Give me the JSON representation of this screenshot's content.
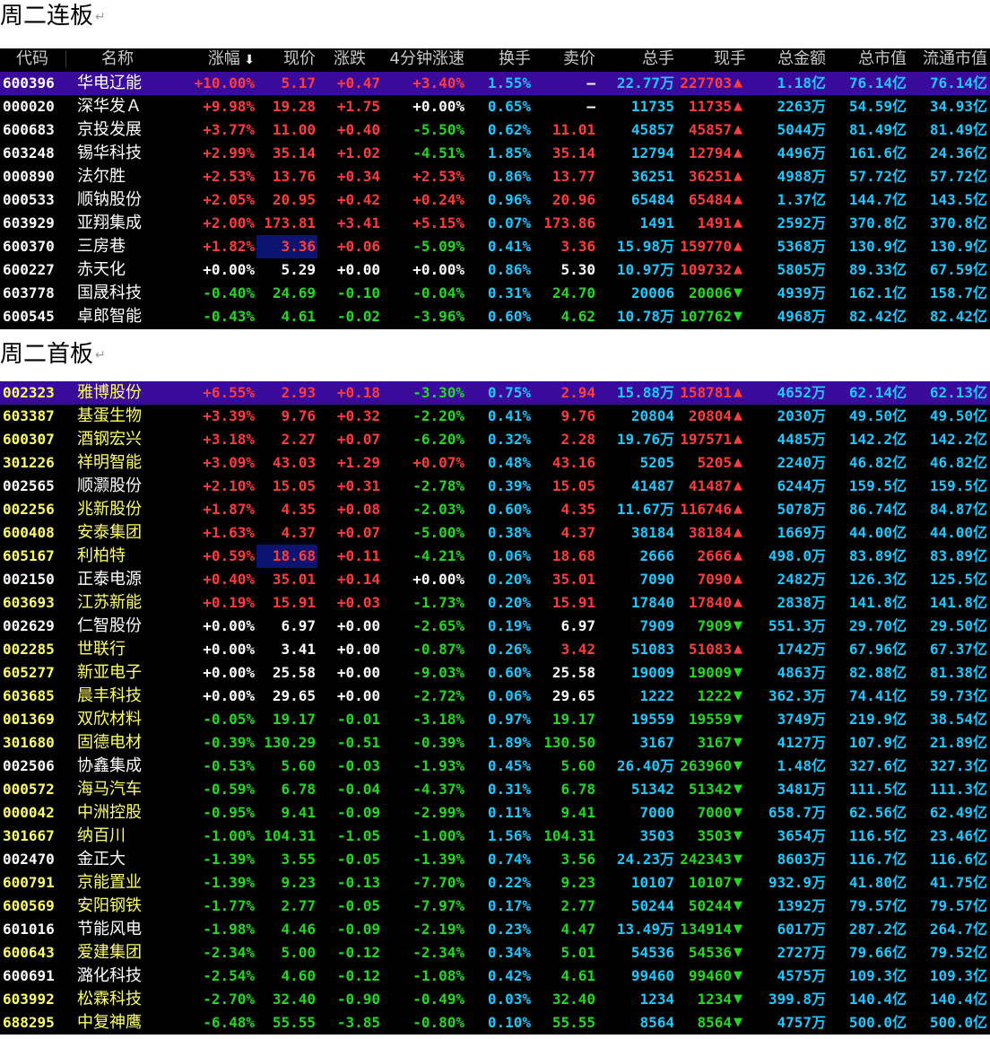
{
  "colors": {
    "up": "#ff3b3b",
    "down": "#22d822",
    "flat": "#ffffff",
    "cyan": "#1ec8ff",
    "yellow": "#ffff66",
    "header": "#c8c8c8",
    "selected_bg": "#3a0a9a",
    "highlight_bg": "#0b1470"
  },
  "headers": {
    "code": "代码",
    "name": "名称",
    "pct": "涨幅",
    "price": "现价",
    "chg": "涨跌",
    "spd": "4分钟涨速",
    "turn": "换手",
    "sell": "卖价",
    "vol": "总手",
    "cur": "现手",
    "amt": "总金额",
    "mcap": "总市值",
    "fcap": "流通市值",
    "sort_icon": "down-arrow-icon"
  },
  "sections": [
    {
      "title": "周二连板",
      "rows": [
        {
          "code": "600396",
          "name": "华电辽能",
          "pct": "+10.00%",
          "price": "5.17",
          "chg": "+0.47",
          "spd": "+3.40%",
          "turn": "1.55%",
          "sell": "–",
          "vol": "22.77万",
          "cur": "227703",
          "dir": "up",
          "amt": "1.18亿",
          "mcap": "76.14亿",
          "fcap": "76.14亿",
          "s": "uuuu",
          "sel": true
        },
        {
          "code": "000020",
          "name": "深华发Ａ",
          "pct": "+9.98%",
          "price": "19.28",
          "chg": "+1.75",
          "spd": "+0.00%",
          "turn": "0.65%",
          "sell": "–",
          "vol": "11735",
          "cur": "11735",
          "dir": "up",
          "amt": "2263万",
          "mcap": "54.59亿",
          "fcap": "34.93亿",
          "s": "uuuf"
        },
        {
          "code": "600683",
          "name": "京投发展",
          "pct": "+3.77%",
          "price": "11.00",
          "chg": "+0.40",
          "spd": "-5.50%",
          "turn": "0.62%",
          "sell": "11.01",
          "vol": "45857",
          "cur": "45857",
          "dir": "up",
          "amt": "5044万",
          "mcap": "81.49亿",
          "fcap": "81.49亿",
          "s": "uuudu"
        },
        {
          "code": "603248",
          "name": "锡华科技",
          "pct": "+2.99%",
          "price": "35.14",
          "chg": "+1.02",
          "spd": "-4.51%",
          "turn": "1.85%",
          "sell": "35.14",
          "vol": "12794",
          "cur": "12794",
          "dir": "up",
          "amt": "4496万",
          "mcap": "161.6亿",
          "fcap": "24.36亿",
          "s": "uuudu"
        },
        {
          "code": "000890",
          "name": "法尔胜",
          "pct": "+2.53%",
          "price": "13.76",
          "chg": "+0.34",
          "spd": "+2.53%",
          "turn": "0.86%",
          "sell": "13.77",
          "vol": "36251",
          "cur": "36251",
          "dir": "up",
          "amt": "4988万",
          "mcap": "57.72亿",
          "fcap": "57.72亿",
          "s": "uuuuu"
        },
        {
          "code": "000533",
          "name": "顺钠股份",
          "pct": "+2.05%",
          "price": "20.95",
          "chg": "+0.42",
          "spd": "+0.24%",
          "turn": "0.96%",
          "sell": "20.96",
          "vol": "65484",
          "cur": "65484",
          "dir": "up",
          "amt": "1.37亿",
          "mcap": "144.7亿",
          "fcap": "143.5亿",
          "s": "uuuuu"
        },
        {
          "code": "603929",
          "name": "亚翔集成",
          "pct": "+2.00%",
          "price": "173.81",
          "chg": "+3.41",
          "spd": "+5.15%",
          "turn": "0.07%",
          "sell": "173.86",
          "vol": "1491",
          "cur": "1491",
          "dir": "up",
          "amt": "2592万",
          "mcap": "370.8亿",
          "fcap": "370.8亿",
          "s": "uuuuu"
        },
        {
          "code": "600370",
          "name": "三房巷",
          "pct": "+1.82%",
          "price": "3.36",
          "chg": "+0.06",
          "spd": "-5.09%",
          "turn": "0.41%",
          "sell": "3.36",
          "vol": "15.98万",
          "cur": "159770",
          "dir": "up",
          "amt": "5368万",
          "mcap": "130.9亿",
          "fcap": "130.9亿",
          "s": "uuudu",
          "hl": true
        },
        {
          "code": "600227",
          "name": "赤天化",
          "pct": "+0.00%",
          "price": "5.29",
          "chg": "+0.00",
          "spd": "+0.00%",
          "turn": "0.86%",
          "sell": "5.30",
          "vol": "10.97万",
          "cur": "109732",
          "dir": "up",
          "amt": "5805万",
          "mcap": "89.33亿",
          "fcap": "67.59亿",
          "s": "fffffu"
        },
        {
          "code": "603778",
          "name": "国晟科技",
          "pct": "-0.40%",
          "price": "24.69",
          "chg": "-0.10",
          "spd": "-0.04%",
          "turn": "0.31%",
          "sell": "24.70",
          "vol": "20006",
          "cur": "20006",
          "dir": "down",
          "amt": "4939万",
          "mcap": "162.1亿",
          "fcap": "158.7亿",
          "s": "ddddd"
        },
        {
          "code": "600545",
          "name": "卓郎智能",
          "pct": "-0.43%",
          "price": "4.61",
          "chg": "-0.02",
          "spd": "-3.96%",
          "turn": "0.60%",
          "sell": "4.62",
          "vol": "10.78万",
          "cur": "107762",
          "dir": "down",
          "amt": "4968万",
          "mcap": "82.42亿",
          "fcap": "82.42亿",
          "s": "ddddd"
        }
      ]
    },
    {
      "title": "周二首板",
      "rows": [
        {
          "code": "002323",
          "name": "雅博股份",
          "pct": "+6.55%",
          "price": "2.93",
          "chg": "+0.18",
          "spd": "-3.30%",
          "turn": "0.75%",
          "sell": "2.94",
          "vol": "15.88万",
          "cur": "158781",
          "dir": "up",
          "amt": "4652万",
          "mcap": "62.14亿",
          "fcap": "62.13亿",
          "s": "uuudu",
          "sel": true,
          "yc": true
        },
        {
          "code": "603387",
          "name": "基蛋生物",
          "pct": "+3.39%",
          "price": "9.76",
          "chg": "+0.32",
          "spd": "-2.20%",
          "turn": "0.41%",
          "sell": "9.76",
          "vol": "20804",
          "cur": "20804",
          "dir": "up",
          "amt": "2030万",
          "mcap": "49.50亿",
          "fcap": "49.50亿",
          "s": "uuudu",
          "yc": true
        },
        {
          "code": "600307",
          "name": "酒钢宏兴",
          "pct": "+3.18%",
          "price": "2.27",
          "chg": "+0.07",
          "spd": "-6.20%",
          "turn": "0.32%",
          "sell": "2.28",
          "vol": "19.76万",
          "cur": "197571",
          "dir": "up",
          "amt": "4485万",
          "mcap": "142.2亿",
          "fcap": "142.2亿",
          "s": "uuudu",
          "yc": true
        },
        {
          "code": "301226",
          "name": "祥明智能",
          "pct": "+3.09%",
          "price": "43.03",
          "chg": "+1.29",
          "spd": "+0.07%",
          "turn": "0.48%",
          "sell": "43.16",
          "vol": "5205",
          "cur": "5205",
          "dir": "up",
          "amt": "2240万",
          "mcap": "46.82亿",
          "fcap": "46.82亿",
          "s": "uuuuu",
          "yc": true
        },
        {
          "code": "002565",
          "name": "顺灏股份",
          "pct": "+2.10%",
          "price": "15.05",
          "chg": "+0.31",
          "spd": "-2.78%",
          "turn": "0.39%",
          "sell": "15.05",
          "vol": "41487",
          "cur": "41487",
          "dir": "up",
          "amt": "6244万",
          "mcap": "159.5亿",
          "fcap": "159.5亿",
          "s": "uuudu"
        },
        {
          "code": "002256",
          "name": "兆新股份",
          "pct": "+1.87%",
          "price": "4.35",
          "chg": "+0.08",
          "spd": "-2.03%",
          "turn": "0.60%",
          "sell": "4.35",
          "vol": "11.67万",
          "cur": "116746",
          "dir": "up",
          "amt": "5078万",
          "mcap": "86.74亿",
          "fcap": "84.87亿",
          "s": "uuudu",
          "yc": true
        },
        {
          "code": "600408",
          "name": "安泰集团",
          "pct": "+1.63%",
          "price": "4.37",
          "chg": "+0.07",
          "spd": "-5.00%",
          "turn": "0.38%",
          "sell": "4.37",
          "vol": "38184",
          "cur": "38184",
          "dir": "up",
          "amt": "1669万",
          "mcap": "44.00亿",
          "fcap": "44.00亿",
          "s": "uuudu",
          "yc": true
        },
        {
          "code": "605167",
          "name": "利柏特",
          "pct": "+0.59%",
          "price": "18.68",
          "chg": "+0.11",
          "spd": "-4.21%",
          "turn": "0.06%",
          "sell": "18.68",
          "vol": "2666",
          "cur": "2666",
          "dir": "up",
          "amt": "498.0万",
          "mcap": "83.89亿",
          "fcap": "83.89亿",
          "s": "uuudu",
          "yc": true,
          "hl": true
        },
        {
          "code": "002150",
          "name": "正泰电源",
          "pct": "+0.40%",
          "price": "35.01",
          "chg": "+0.14",
          "spd": "+0.00%",
          "turn": "0.20%",
          "sell": "35.01",
          "vol": "7090",
          "cur": "7090",
          "dir": "up",
          "amt": "2482万",
          "mcap": "126.3亿",
          "fcap": "125.5亿",
          "s": "uuufu"
        },
        {
          "code": "603693",
          "name": "江苏新能",
          "pct": "+0.19%",
          "price": "15.91",
          "chg": "+0.03",
          "spd": "-1.73%",
          "turn": "0.20%",
          "sell": "15.91",
          "vol": "17840",
          "cur": "17840",
          "dir": "up",
          "amt": "2838万",
          "mcap": "141.8亿",
          "fcap": "141.8亿",
          "s": "uuudu",
          "yc": true
        },
        {
          "code": "002629",
          "name": "仁智股份",
          "pct": "+0.00%",
          "price": "6.97",
          "chg": "+0.00",
          "spd": "-2.65%",
          "turn": "0.19%",
          "sell": "6.97",
          "vol": "7909",
          "cur": "7909",
          "dir": "down",
          "amt": "551.3万",
          "mcap": "29.70亿",
          "fcap": "29.50亿",
          "s": "fffdf"
        },
        {
          "code": "002285",
          "name": "世联行",
          "pct": "+0.00%",
          "price": "3.41",
          "chg": "+0.00",
          "spd": "-0.87%",
          "turn": "0.26%",
          "sell": "3.42",
          "vol": "51083",
          "cur": "51083",
          "dir": "up",
          "amt": "1742万",
          "mcap": "67.96亿",
          "fcap": "67.37亿",
          "s": "fffdu",
          "yc": true
        },
        {
          "code": "605277",
          "name": "新亚电子",
          "pct": "+0.00%",
          "price": "25.58",
          "chg": "+0.00",
          "spd": "-9.03%",
          "turn": "0.60%",
          "sell": "25.58",
          "vol": "19009",
          "cur": "19009",
          "dir": "down",
          "amt": "4863万",
          "mcap": "82.88亿",
          "fcap": "81.38亿",
          "s": "fffdf",
          "yc": true
        },
        {
          "code": "603685",
          "name": "晨丰科技",
          "pct": "+0.00%",
          "price": "29.65",
          "chg": "+0.00",
          "spd": "-2.72%",
          "turn": "0.06%",
          "sell": "29.65",
          "vol": "1222",
          "cur": "1222",
          "dir": "down",
          "amt": "362.3万",
          "mcap": "74.41亿",
          "fcap": "59.73亿",
          "s": "fffdf",
          "yc": true
        },
        {
          "code": "001369",
          "name": "双欣材料",
          "pct": "-0.05%",
          "price": "19.17",
          "chg": "-0.01",
          "spd": "-3.18%",
          "turn": "0.97%",
          "sell": "19.17",
          "vol": "19559",
          "cur": "19559",
          "dir": "down",
          "amt": "3749万",
          "mcap": "219.9亿",
          "fcap": "38.54亿",
          "s": "ddddd",
          "yc": true
        },
        {
          "code": "301680",
          "name": "固德电材",
          "pct": "-0.39%",
          "price": "130.29",
          "chg": "-0.51",
          "spd": "-0.39%",
          "turn": "1.89%",
          "sell": "130.50",
          "vol": "3167",
          "cur": "3167",
          "dir": "down",
          "amt": "4127万",
          "mcap": "107.9亿",
          "fcap": "21.89亿",
          "s": "ddddd",
          "yc": true
        },
        {
          "code": "002506",
          "name": "协鑫集成",
          "pct": "-0.53%",
          "price": "5.60",
          "chg": "-0.03",
          "spd": "-1.93%",
          "turn": "0.45%",
          "sell": "5.60",
          "vol": "26.40万",
          "cur": "263960",
          "dir": "down",
          "amt": "1.48亿",
          "mcap": "327.6亿",
          "fcap": "327.3亿",
          "s": "ddddd"
        },
        {
          "code": "000572",
          "name": "海马汽车",
          "pct": "-0.59%",
          "price": "6.78",
          "chg": "-0.04",
          "spd": "-4.37%",
          "turn": "0.31%",
          "sell": "6.78",
          "vol": "51342",
          "cur": "51342",
          "dir": "down",
          "amt": "3481万",
          "mcap": "111.5亿",
          "fcap": "111.3亿",
          "s": "ddddd",
          "yc": true
        },
        {
          "code": "000042",
          "name": "中洲控股",
          "pct": "-0.95%",
          "price": "9.41",
          "chg": "-0.09",
          "spd": "-2.99%",
          "turn": "0.11%",
          "sell": "9.41",
          "vol": "7000",
          "cur": "7000",
          "dir": "down",
          "amt": "658.7万",
          "mcap": "62.56亿",
          "fcap": "62.49亿",
          "s": "ddddd",
          "yc": true
        },
        {
          "code": "301667",
          "name": "纳百川",
          "pct": "-1.00%",
          "price": "104.31",
          "chg": "-1.05",
          "spd": "-1.00%",
          "turn": "1.56%",
          "sell": "104.31",
          "vol": "3503",
          "cur": "3503",
          "dir": "down",
          "amt": "3654万",
          "mcap": "116.5亿",
          "fcap": "23.46亿",
          "s": "ddddd",
          "yc": true
        },
        {
          "code": "002470",
          "name": "金正大",
          "pct": "-1.39%",
          "price": "3.55",
          "chg": "-0.05",
          "spd": "-1.39%",
          "turn": "0.74%",
          "sell": "3.56",
          "vol": "24.23万",
          "cur": "242343",
          "dir": "down",
          "amt": "8603万",
          "mcap": "116.7亿",
          "fcap": "116.6亿",
          "s": "ddddd"
        },
        {
          "code": "600791",
          "name": "京能置业",
          "pct": "-1.39%",
          "price": "9.23",
          "chg": "-0.13",
          "spd": "-7.70%",
          "turn": "0.22%",
          "sell": "9.23",
          "vol": "10107",
          "cur": "10107",
          "dir": "down",
          "amt": "932.9万",
          "mcap": "41.80亿",
          "fcap": "41.75亿",
          "s": "ddddd",
          "yc": true
        },
        {
          "code": "600569",
          "name": "安阳钢铁",
          "pct": "-1.77%",
          "price": "2.77",
          "chg": "-0.05",
          "spd": "-7.97%",
          "turn": "0.17%",
          "sell": "2.77",
          "vol": "50244",
          "cur": "50244",
          "dir": "down",
          "amt": "1392万",
          "mcap": "79.57亿",
          "fcap": "79.57亿",
          "s": "ddddd",
          "yc": true
        },
        {
          "code": "601016",
          "name": "节能风电",
          "pct": "-1.98%",
          "price": "4.46",
          "chg": "-0.09",
          "spd": "-2.19%",
          "turn": "0.23%",
          "sell": "4.47",
          "vol": "13.49万",
          "cur": "134914",
          "dir": "down",
          "amt": "6017万",
          "mcap": "287.2亿",
          "fcap": "264.7亿",
          "s": "ddddd"
        },
        {
          "code": "600643",
          "name": "爱建集团",
          "pct": "-2.34%",
          "price": "5.00",
          "chg": "-0.12",
          "spd": "-2.34%",
          "turn": "0.34%",
          "sell": "5.01",
          "vol": "54536",
          "cur": "54536",
          "dir": "down",
          "amt": "2727万",
          "mcap": "79.66亿",
          "fcap": "79.52亿",
          "s": "ddddd",
          "yc": true
        },
        {
          "code": "600691",
          "name": "潞化科技",
          "pct": "-2.54%",
          "price": "4.60",
          "chg": "-0.12",
          "spd": "-1.08%",
          "turn": "0.42%",
          "sell": "4.61",
          "vol": "99460",
          "cur": "99460",
          "dir": "down",
          "amt": "4575万",
          "mcap": "109.3亿",
          "fcap": "109.3亿",
          "s": "ddddd"
        },
        {
          "code": "603992",
          "name": "松霖科技",
          "pct": "-2.70%",
          "price": "32.40",
          "chg": "-0.90",
          "spd": "-0.49%",
          "turn": "0.03%",
          "sell": "32.40",
          "vol": "1234",
          "cur": "1234",
          "dir": "down",
          "amt": "399.8万",
          "mcap": "140.4亿",
          "fcap": "140.4亿",
          "s": "ddddd",
          "yc": true
        },
        {
          "code": "688295",
          "name": "中复神鹰",
          "pct": "-6.48%",
          "price": "55.55",
          "chg": "-3.85",
          "spd": "-0.80%",
          "turn": "0.10%",
          "sell": "55.55",
          "vol": "8564",
          "cur": "8564",
          "dir": "down",
          "amt": "4757万",
          "mcap": "500.0亿",
          "fcap": "500.0亿",
          "s": "ddddd",
          "yc": true
        }
      ]
    }
  ]
}
